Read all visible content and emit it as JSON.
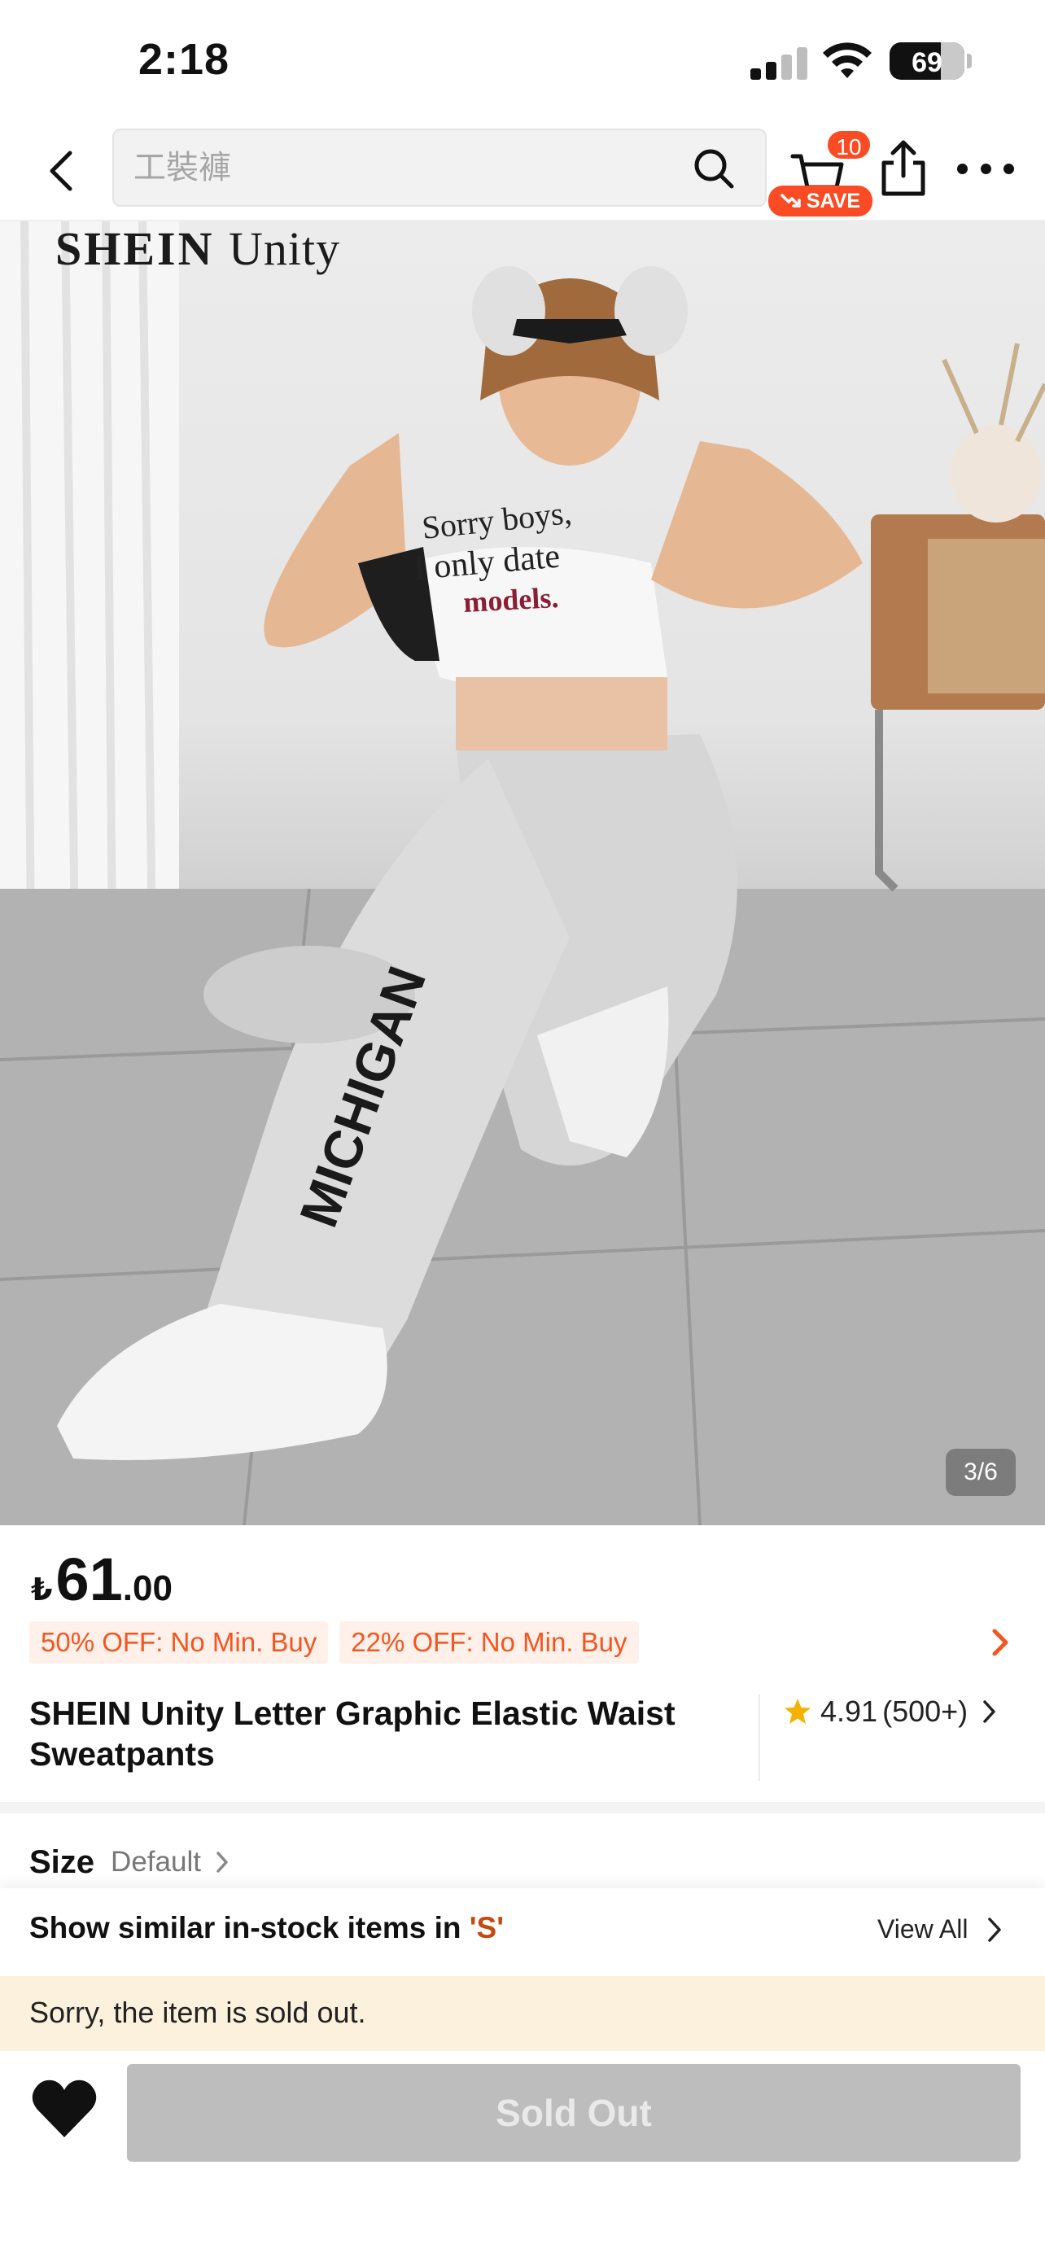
{
  "status_bar": {
    "time": "2:18",
    "battery": "69"
  },
  "nav": {
    "search_placeholder": "工裝褲",
    "cart_count": "10",
    "save_label": "SAVE"
  },
  "gallery": {
    "brand_watermark": "SHEIN",
    "brand_watermark_sub": "Unity",
    "page_indicator": "3/6",
    "shirt_text": [
      "Sorry boys,",
      "I only date",
      "models."
    ],
    "pants_text": "MICHIGAN"
  },
  "price": {
    "currency": "₺",
    "integer": "61",
    "decimal": ".00"
  },
  "promotions": [
    "50% OFF: No Min. Buy",
    "22% OFF: No Min. Buy"
  ],
  "product": {
    "title": "SHEIN Unity Letter Graphic Elastic Waist Sweatpants",
    "rating": "4.91",
    "review_count": "(500+)"
  },
  "size": {
    "label": "Size",
    "value": "Default"
  },
  "similar": {
    "text_prefix": "Show similar in-stock items in ",
    "size": "'S'",
    "view_all": "View All"
  },
  "sold_out_notice": "Sorry, the item is sold out.",
  "bottom": {
    "sold_out_label": "Sold Out"
  },
  "colors": {
    "accent": "#fa4b24",
    "promo_text": "#f4561f",
    "promo_bg": "#fff0ea",
    "banner_bg": "#fcf1dc",
    "disabled_btn": "#bdbdbd"
  }
}
